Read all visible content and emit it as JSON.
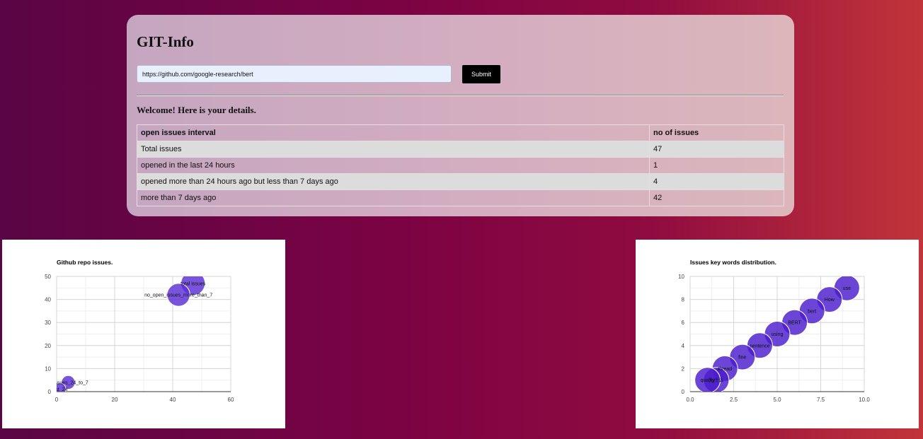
{
  "app": {
    "title": "GIT-Info",
    "url_value": "https://github.com/google-research/bert",
    "submit_label": "Submit",
    "welcome": "Welcome! Here is your details."
  },
  "table": {
    "headers": [
      "open issues interval",
      "no of issues"
    ],
    "rows": [
      [
        "Total issues",
        "47"
      ],
      [
        "opened in the last 24 hours",
        "1"
      ],
      [
        "opened more than 24 hours ago but less than 7 days ago",
        "4"
      ],
      [
        "more than 7 days ago",
        "42"
      ]
    ]
  },
  "chart_data": [
    {
      "type": "scatter",
      "title": "Github repo issues.",
      "xlim": [
        0,
        60
      ],
      "ylim": [
        0,
        50
      ],
      "xticks": [
        0,
        20,
        40,
        60
      ],
      "yticks": [
        0,
        10,
        20,
        30,
        40,
        50
      ],
      "grid": true,
      "bubble_color": "#5b2fd6",
      "points": [
        {
          "label": "total issues",
          "x": 47,
          "y": 47,
          "size": 47
        },
        {
          "label": "no_open_issues_more_than_7",
          "x": 42,
          "y": 42,
          "size": 42
        },
        {
          "label": "n_issues_24_to_7",
          "x": 4,
          "y": 4,
          "size": 4
        },
        {
          "label": "last_24",
          "x": 1,
          "y": 1,
          "size": 1
        }
      ]
    },
    {
      "type": "scatter",
      "title": "Issues key words distribution.",
      "xlim": [
        0,
        10
      ],
      "ylim": [
        0,
        10
      ],
      "xticks": [
        "0.0",
        "2.5",
        "5.0",
        "7.5",
        "10.0"
      ],
      "yticks": [
        0,
        2,
        4,
        6,
        8,
        10
      ],
      "grid": true,
      "bubble_color": "#4a1ccc",
      "points": [
        {
          "label": "use",
          "x": 9,
          "y": 9
        },
        {
          "label": "How",
          "x": 8,
          "y": 8
        },
        {
          "label": "bert",
          "x": 7,
          "y": 7
        },
        {
          "label": "BERT",
          "x": 6,
          "y": 6
        },
        {
          "label": "using",
          "x": 5,
          "y": 5
        },
        {
          "label": "sentence",
          "x": 4,
          "y": 4
        },
        {
          "label": "fine",
          "x": 3,
          "y": 3
        },
        {
          "label": "thread",
          "x": 2,
          "y": 2
        },
        {
          "label": "为什么",
          "x": 1.5,
          "y": 1
        },
        {
          "label": "quality",
          "x": 1,
          "y": 1
        }
      ]
    }
  ]
}
